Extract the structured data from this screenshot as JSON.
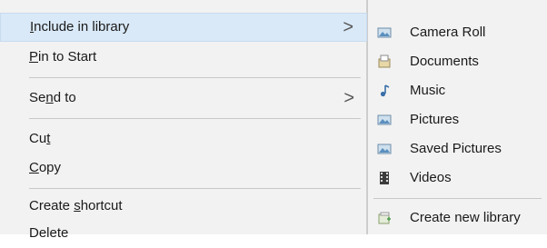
{
  "main_menu": {
    "items": [
      {
        "pre": "",
        "acc": "I",
        "post": "nclude in library"
      },
      {
        "pre": "",
        "acc": "P",
        "post": "in to Start"
      },
      {
        "pre": "Se",
        "acc": "n",
        "post": "d to"
      },
      {
        "pre": "Cu",
        "acc": "t",
        "post": ""
      },
      {
        "pre": "",
        "acc": "C",
        "post": "opy"
      },
      {
        "pre": "Create ",
        "acc": "s",
        "post": "hortcut"
      },
      {
        "pre": "Delete",
        "acc": "",
        "post": ""
      }
    ],
    "chevron": ">"
  },
  "sub_menu": {
    "items": [
      {
        "label": "Camera Roll",
        "icon": "pictures-library-icon"
      },
      {
        "label": "Documents",
        "icon": "documents-library-icon"
      },
      {
        "label": "Music",
        "icon": "music-library-icon"
      },
      {
        "label": "Pictures",
        "icon": "pictures-library-icon"
      },
      {
        "label": "Saved Pictures",
        "icon": "pictures-library-icon"
      },
      {
        "label": "Videos",
        "icon": "videos-library-icon"
      }
    ],
    "create_new": {
      "label": "Create new library",
      "icon": "new-library-icon"
    }
  },
  "colors": {
    "highlight": "#d9e9f7",
    "menu_bg": "#f2f2f2",
    "separator": "#c8c8c8"
  }
}
